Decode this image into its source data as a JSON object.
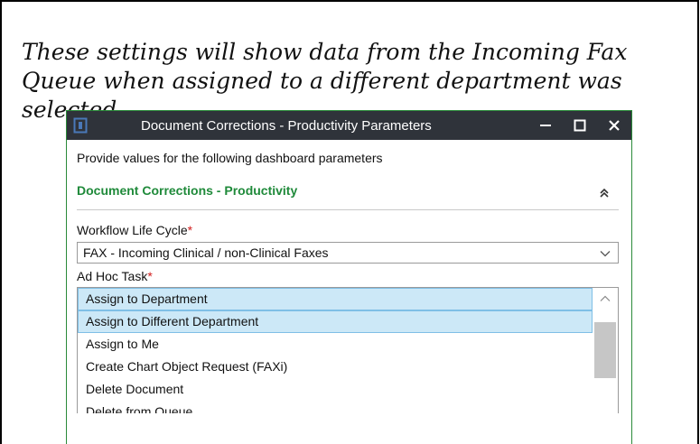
{
  "caption": "These settings will show data from the Incoming Fax Queue when assigned to a different department was selected.",
  "dialog": {
    "title": "Document Corrections - Productivity Parameters",
    "prompt": "Provide values for the following dashboard parameters",
    "section_title": "Document Corrections - Productivity",
    "workflow_label": "Workflow Life Cycle",
    "required_marker": "*",
    "workflow_value": "FAX - Incoming Clinical / non-Clinical Faxes",
    "adhoc_label": "Ad Hoc Task",
    "adhoc_items": [
      "Assign to Department",
      "Assign to Different Department",
      "Assign to Me",
      "Create Chart Object Request (FAXi)",
      "Delete Document",
      "Delete from Queue"
    ]
  },
  "colors": {
    "titlebar": "#2f333a",
    "accent_green": "#1f8a3a",
    "selection": "#cce8f7",
    "required": "#d11a1a"
  },
  "icons": {
    "app": "app-icon",
    "minimize": "minimize-icon",
    "maximize": "maximize-icon",
    "close": "close-icon",
    "collapse": "double-chevron-up-icon",
    "dropdown": "chevron-down-icon",
    "scroll_up": "chevron-up-icon"
  }
}
